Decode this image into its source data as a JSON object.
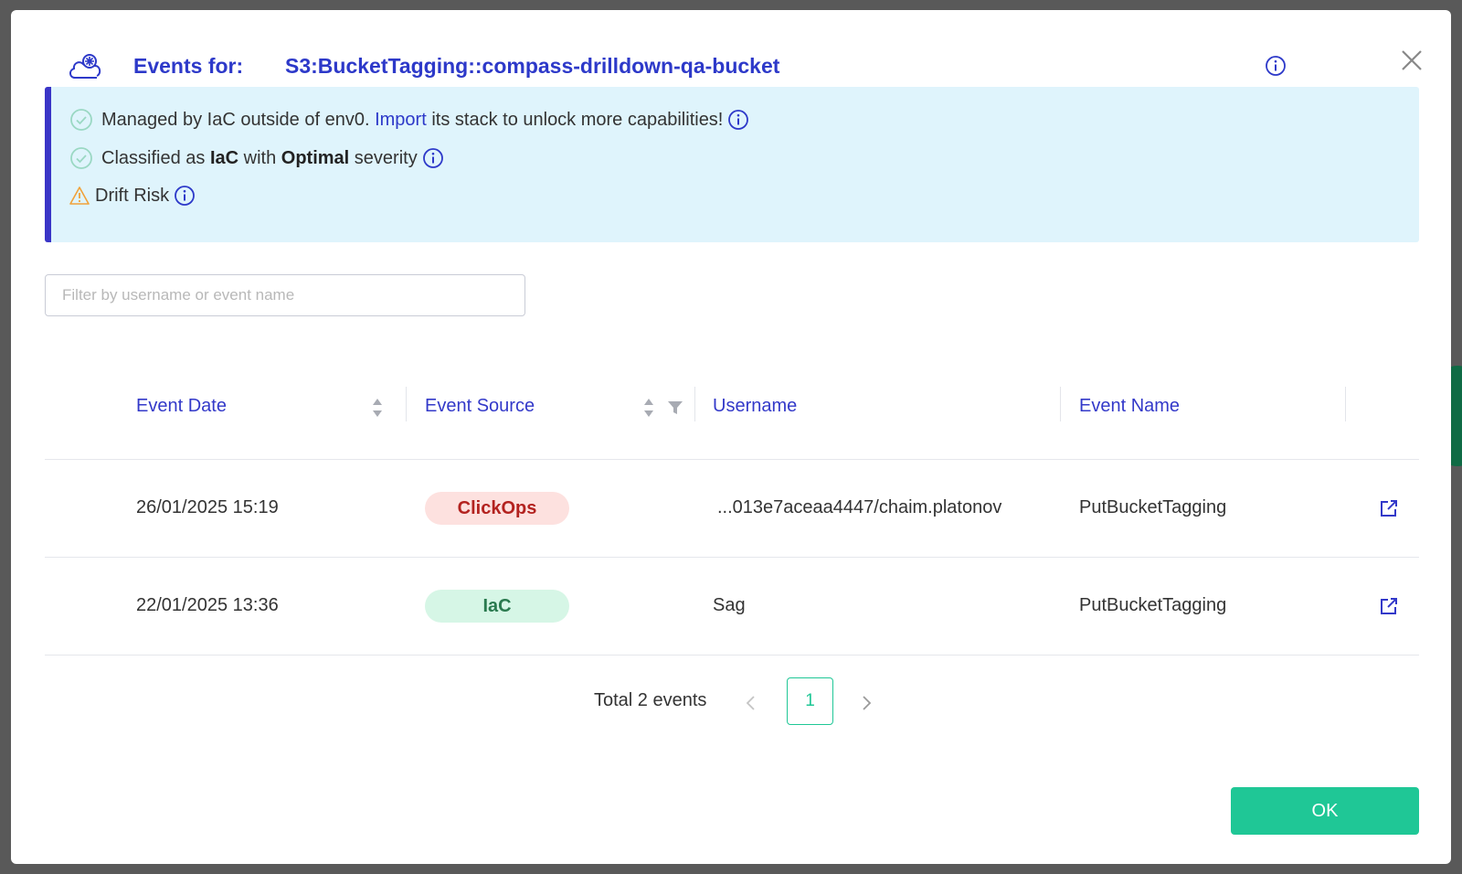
{
  "header": {
    "label": "Events for:",
    "resource": "S3:BucketTagging::compass-drilldown-qa-bucket"
  },
  "banner": {
    "managed_prefix": "Managed by IaC outside of env0.",
    "import_link": "Import",
    "managed_suffix": "its stack to unlock more capabilities!",
    "classified_prefix": "Classified as",
    "classified_type": "IaC",
    "classified_mid": "with",
    "classified_severity": "Optimal",
    "classified_suffix": "severity",
    "drift_label": "Drift Risk"
  },
  "filter": {
    "placeholder": "Filter by username or event name",
    "value": ""
  },
  "table": {
    "columns": [
      "Event Date",
      "Event Source",
      "Username",
      "Event Name"
    ],
    "rows": [
      {
        "date": "26/01/2025 15:19",
        "source": "ClickOps",
        "username": "...013e7aceaa4447/chaim.platonov",
        "event_name": "PutBucketTagging"
      },
      {
        "date": "22/01/2025 13:36",
        "source": "IaC",
        "username": "Sag",
        "event_name": "PutBucketTagging"
      }
    ]
  },
  "pagination": {
    "total": "Total 2 events",
    "current_page": "1"
  },
  "footer": {
    "ok_label": "OK"
  },
  "colors": {
    "accent": "#2d39c9",
    "primary_button": "#1fc796",
    "banner_bg": "#dff4fc",
    "clickops_bg": "#fde1df",
    "clickops_text": "#b3221f",
    "iac_bg": "#d6f6e6",
    "iac_text": "#2a7a4f"
  }
}
